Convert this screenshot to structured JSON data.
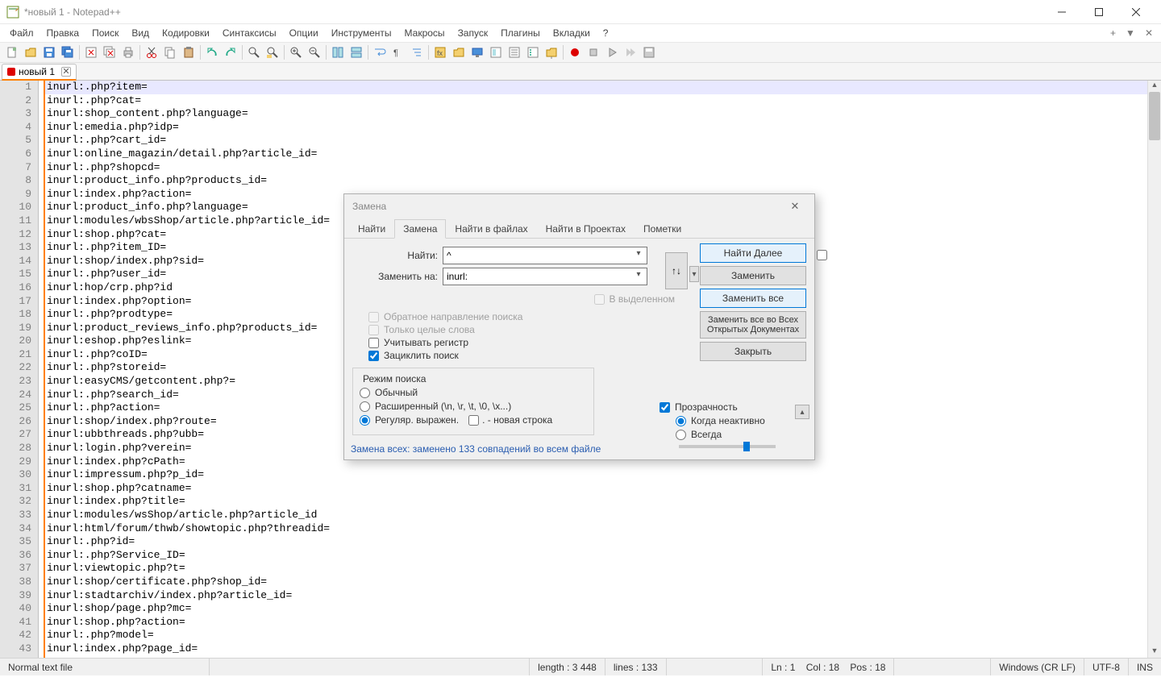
{
  "title": "*новый 1 - Notepad++",
  "menu": [
    "Файл",
    "Правка",
    "Поиск",
    "Вид",
    "Кодировки",
    "Синтаксисы",
    "Опции",
    "Инструменты",
    "Макросы",
    "Запуск",
    "Плагины",
    "Вкладки",
    "?"
  ],
  "tab": {
    "label": "новый 1"
  },
  "code_lines": [
    "inurl:.php?item=",
    "inurl:.php?cat=",
    "inurl:shop_content.php?language=",
    "inurl:emedia.php?idp=",
    "inurl:.php?cart_id=",
    "inurl:online_magazin/detail.php?article_id=",
    "inurl:.php?shopcd=",
    "inurl:product_info.php?products_id=",
    "inurl:index.php?action=",
    "inurl:product_info.php?language=",
    "inurl:modules/wbsShop/article.php?article_id=",
    "inurl:shop.php?cat=",
    "inurl:.php?item_ID=",
    "inurl:shop/index.php?sid=",
    "inurl:.php?user_id=",
    "inurl:hop/crp.php?id",
    "inurl:index.php?option=",
    "inurl:.php?prodtype=",
    "inurl:product_reviews_info.php?products_id=",
    "inurl:eshop.php?eslink=",
    "inurl:.php?coID=",
    "inurl:.php?storeid=",
    "inurl:easyCMS/getcontent.php?=",
    "inurl:.php?search_id=",
    "inurl:.php?action=",
    "inurl:shop/index.php?route=",
    "inurl:ubbthreads.php?ubb=",
    "inurl:login.php?verein=",
    "inurl:index.php?cPath=",
    "inurl:impressum.php?p_id=",
    "inurl:shop.php?catname=",
    "inurl:index.php?title=",
    "inurl:modules/wsShop/article.php?article_id",
    "inurl:html/forum/thwb/showtopic.php?threadid=",
    "inurl:.php?id=",
    "inurl:.php?Service_ID=",
    "inurl:viewtopic.php?t=",
    "inurl:shop/certificate.php?shop_id=",
    "inurl:stadtarchiv/index.php?article_id=",
    "inurl:shop/page.php?mc=",
    "inurl:shop.php?action=",
    "inurl:.php?model=",
    "inurl:index.php?page_id="
  ],
  "dialog": {
    "title": "Замена",
    "tabs": [
      "Найти",
      "Замена",
      "Найти в файлах",
      "Найти в Проектах",
      "Пометки"
    ],
    "active_tab": 1,
    "find_label": "Найти:",
    "find_value": "^",
    "replace_label": "Заменить на:",
    "replace_value": "inurl:",
    "in_selection": "В выделенном",
    "backward": "Обратное направление поиска",
    "whole_word": "Только целые слова",
    "match_case": "Учитывать регистр",
    "wrap": "Зациклить поиск",
    "mode_legend": "Режим поиска",
    "mode_normal": "Обычный",
    "mode_ext": "Расширенный (\\n, \\r, \\t, \\0, \\x...)",
    "mode_regex": "Регуляр. выражен.",
    "mode_dotnl": ". - новая строка",
    "trans": "Прозрачность",
    "trans_inactive": "Когда неактивно",
    "trans_always": "Всегда",
    "btn_find_next": "Найти Далее",
    "btn_replace": "Заменить",
    "btn_replace_all": "Заменить все",
    "btn_replace_all_docs": "Заменить все во Всех Открытых Документах",
    "btn_close": "Закрыть",
    "swap_icon": "↑↓",
    "status": "Замена всех: заменено 133 совпадений во всем файле"
  },
  "statusbar": {
    "filetype": "Normal text file",
    "length": "length : 3 448",
    "lines": "lines : 133",
    "pos": "Ln : 1    Col : 18    Pos : 18",
    "eol": "Windows (CR LF)",
    "enc": "UTF-8",
    "ins": "INS"
  }
}
